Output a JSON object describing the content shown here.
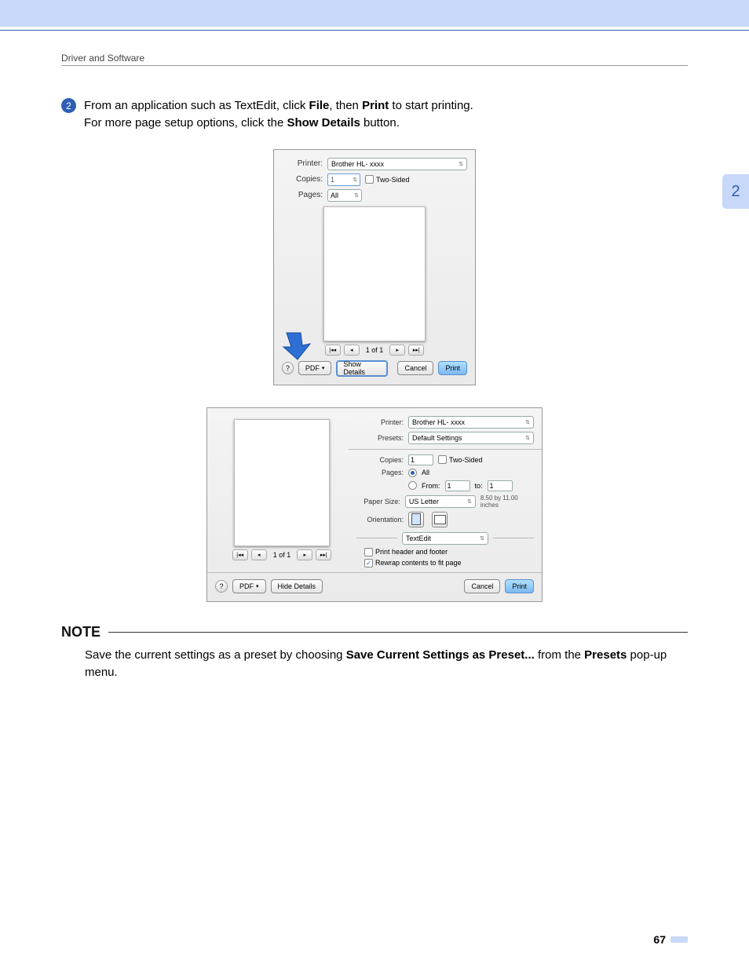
{
  "header": {
    "section_title": "Driver and Software",
    "chapter_number": "2"
  },
  "step": {
    "number": "2",
    "line1_prefix": "From an application such as TextEdit, click ",
    "line1_bold1": "File",
    "line1_mid": ", then ",
    "line1_bold2": "Print",
    "line1_suffix": " to start printing.",
    "line2_prefix": "For more page setup options, click the ",
    "line2_bold": "Show Details",
    "line2_suffix": " button."
  },
  "dialog1": {
    "printer_label": "Printer:",
    "printer_value": "Brother HL- xxxx",
    "copies_label": "Copies:",
    "copies_value": "1",
    "two_sided_label": "Two-Sided",
    "pages_label": "Pages:",
    "pages_value": "All",
    "pager_text": "1 of 1",
    "pdf_label": "PDF",
    "show_details_label": "Show Details",
    "cancel_label": "Cancel",
    "print_label": "Print"
  },
  "dialog2": {
    "printer_label": "Printer:",
    "printer_value": "Brother HL- xxxx",
    "presets_label": "Presets:",
    "presets_value": "Default Settings",
    "copies_label": "Copies:",
    "copies_value": "1",
    "two_sided_label": "Two-Sided",
    "pages_label": "Pages:",
    "pages_all_label": "All",
    "pages_from_label": "From:",
    "pages_from_value": "1",
    "pages_to_label": "to:",
    "pages_to_value": "1",
    "paper_size_label": "Paper Size:",
    "paper_size_value": "US Letter",
    "paper_size_dims": "8.50 by 11.00 inches",
    "orientation_label": "Orientation:",
    "section_popup_value": "TextEdit",
    "opt_header_footer": "Print header and footer",
    "opt_rewrap": "Rewrap contents to fit page",
    "pager_text": "1 of 1",
    "pdf_label": "PDF",
    "hide_details_label": "Hide Details",
    "cancel_label": "Cancel",
    "print_label": "Print"
  },
  "note": {
    "heading": "NOTE",
    "body_prefix": "Save the current settings as a preset by choosing ",
    "body_bold1": "Save Current Settings as Preset...",
    "body_mid": " from the ",
    "body_bold2": "Presets",
    "body_suffix": " pop-up menu."
  },
  "page_number": "67"
}
